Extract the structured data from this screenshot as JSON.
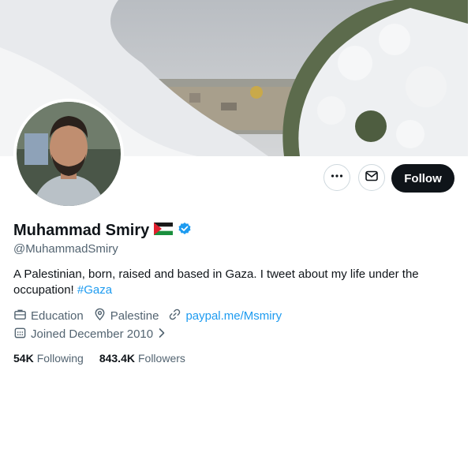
{
  "profile": {
    "name": "Muhammad Smiry",
    "handle": "@MuhammadSmiry",
    "bio_text": "A Palestinian, born, raised and based in Gaza. I tweet about my life under the occupation!",
    "bio_hashtag": "#Gaza",
    "category": "Education",
    "location": "Palestine",
    "website": "paypal.me/Msmiry",
    "joined": "Joined December 2010",
    "following_count": "54K",
    "following_label": "Following",
    "followers_count": "843.4K",
    "followers_label": "Followers",
    "verified": true
  },
  "actions": {
    "follow_label": "Follow"
  },
  "icons": {
    "more": "more-icon",
    "message": "envelope-icon",
    "verified": "verified-badge-icon",
    "flag": "palestine-flag-icon",
    "category": "briefcase-icon",
    "location": "location-pin-icon",
    "website": "link-icon",
    "joined": "calendar-icon",
    "chevron": "chevron-right-icon"
  },
  "colors": {
    "accent": "#1d9bf0",
    "text": "#0f1419",
    "secondary": "#536471",
    "button": "#0f1419"
  }
}
